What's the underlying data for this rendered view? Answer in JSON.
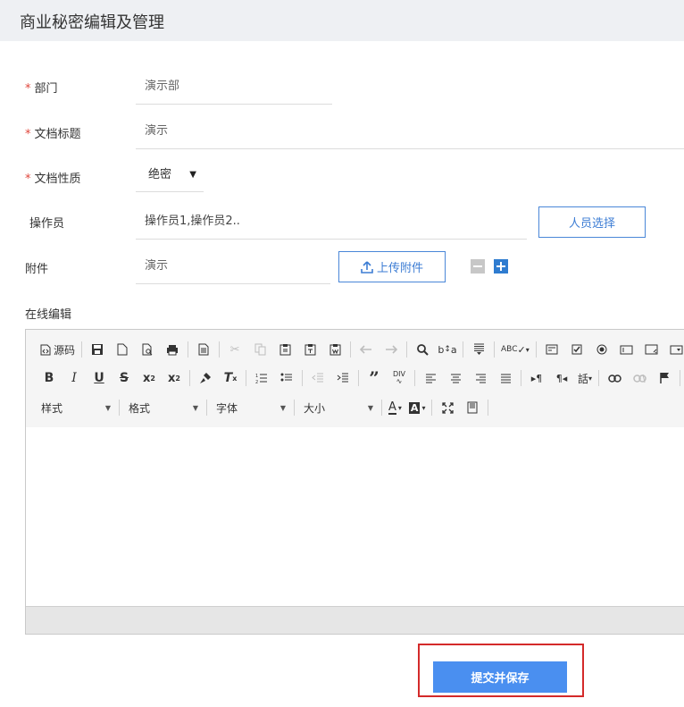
{
  "page": {
    "title": "商业秘密编辑及管理"
  },
  "form": {
    "required_mark": "*",
    "department": {
      "label": "部门",
      "value": "演示部"
    },
    "doc_title": {
      "label": "文档标题",
      "value": "演示"
    },
    "doc_nature": {
      "label": "文档性质",
      "value": "绝密"
    },
    "operator": {
      "label": "操作员",
      "value": "操作员1,操作员2..",
      "select_button": "人员选择"
    },
    "attachment": {
      "label": "附件",
      "value": "演示",
      "upload_button": "上传附件"
    },
    "online_edit": {
      "label": "在线编辑"
    }
  },
  "editor": {
    "source_label": "源码",
    "combos": {
      "style": "样式",
      "format": "格式",
      "font": "字体",
      "size": "大小"
    },
    "content": ""
  },
  "submit": {
    "label": "提交并保存"
  },
  "colors": {
    "accent": "#4a8ff0",
    "required": "#e0453b",
    "highlight_frame": "#d42a2a"
  }
}
